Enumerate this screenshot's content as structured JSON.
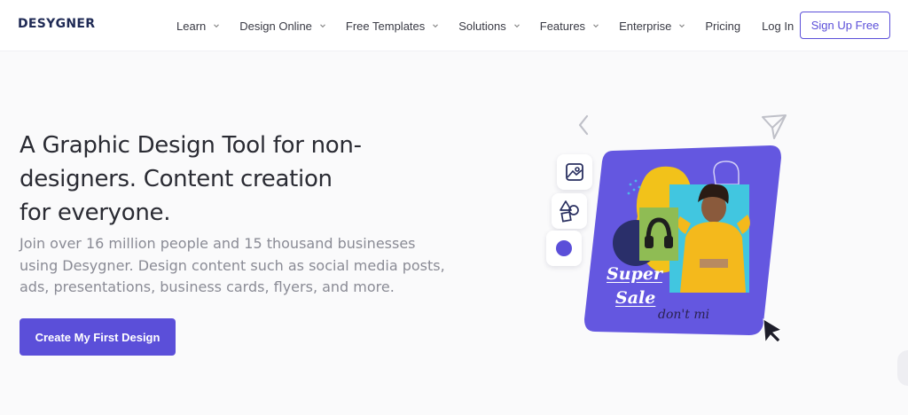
{
  "brand": {
    "logo_text": "DESYGNER",
    "accent": "#5b4fd9",
    "dark": "#1f2a55"
  },
  "nav": {
    "items": [
      {
        "label": "Learn",
        "dropdown": true
      },
      {
        "label": "Design Online",
        "dropdown": true
      },
      {
        "label": "Free Templates",
        "dropdown": true
      },
      {
        "label": "Solutions",
        "dropdown": true
      },
      {
        "label": "Features",
        "dropdown": true
      },
      {
        "label": "Enterprise",
        "dropdown": true
      },
      {
        "label": "Pricing",
        "dropdown": false
      },
      {
        "label": "Log In",
        "dropdown": false
      }
    ],
    "signup_label": "Sign Up Free"
  },
  "hero": {
    "title_lines": [
      "A Graphic Design Tool for non-",
      "designers. Content creation",
      "for everyone."
    ],
    "subtitle_lines": [
      "Join over 16 million people and 15 thousand businesses",
      "using Desygner. Design content such as social media posts,",
      "ads, presentations, business cards, flyers, and more."
    ],
    "cta_label": "Create My First Design"
  },
  "illustration": {
    "card_text_1": "Super",
    "card_text_2": "Sale",
    "card_text_3": "don't mi",
    "tools": [
      "image-icon",
      "shapes-icon",
      "color-dot-icon"
    ],
    "card_color": "#6457e0",
    "blob_color": "#f2c21a"
  }
}
